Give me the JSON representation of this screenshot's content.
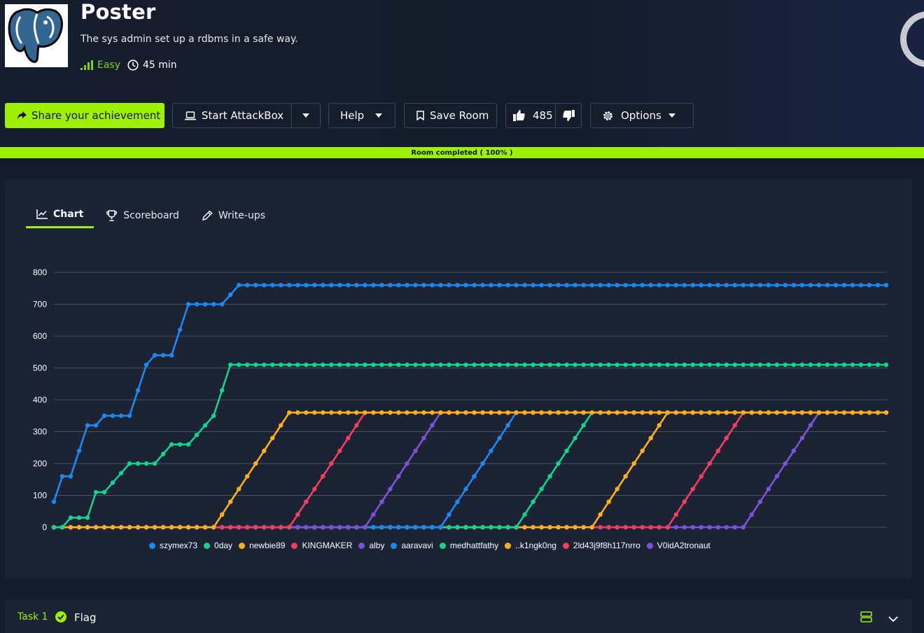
{
  "room": {
    "title": "Poster",
    "description": "The sys admin set up a rdbms in a safe way.",
    "difficulty": "Easy",
    "duration": "45 min",
    "logo_icon": "postgresql-elephant-icon"
  },
  "toolbar": {
    "share_label": "Share your achievement",
    "attackbox_label": "Start AttackBox",
    "help_label": "Help",
    "save_label": "Save Room",
    "votes": "485",
    "options_label": "Options"
  },
  "progress": {
    "label": "Room completed ( 100% )",
    "percent": 100
  },
  "tabs": [
    {
      "label": "Chart",
      "icon": "line-chart-icon",
      "active": true
    },
    {
      "label": "Scoreboard",
      "icon": "trophy-icon",
      "active": false
    },
    {
      "label": "Write-ups",
      "icon": "pencil-icon",
      "active": false
    }
  ],
  "chart_data": {
    "type": "line",
    "ylim": [
      0,
      800
    ],
    "yticks": [
      "800",
      "700",
      "600",
      "500",
      "400",
      "300",
      "200",
      "100",
      "0"
    ],
    "grid": true,
    "legend_placement": "bottom",
    "point_count": 100,
    "series": [
      {
        "name": "szymex73",
        "color": "#1e88f2",
        "points": [
          [
            0,
            80
          ],
          [
            1,
            160
          ],
          [
            2,
            160
          ],
          [
            3,
            240
          ],
          [
            4,
            320
          ],
          [
            5,
            320
          ],
          [
            6,
            350
          ],
          [
            7,
            350
          ],
          [
            8,
            350
          ],
          [
            9,
            350
          ],
          [
            10,
            430
          ],
          [
            11,
            510
          ],
          [
            12,
            540
          ],
          [
            13,
            540
          ],
          [
            14,
            540
          ],
          [
            15,
            620
          ],
          [
            16,
            700
          ],
          [
            17,
            700
          ],
          [
            18,
            700
          ],
          [
            19,
            700
          ],
          [
            20,
            700
          ],
          [
            21,
            730
          ],
          [
            22,
            760
          ],
          [
            99,
            760
          ]
        ]
      },
      {
        "name": "0day",
        "color": "#14d48c",
        "points": [
          [
            0,
            0
          ],
          [
            1,
            0
          ],
          [
            2,
            30
          ],
          [
            3,
            30
          ],
          [
            4,
            30
          ],
          [
            5,
            110
          ],
          [
            6,
            110
          ],
          [
            7,
            140
          ],
          [
            8,
            170
          ],
          [
            9,
            200
          ],
          [
            10,
            200
          ],
          [
            11,
            200
          ],
          [
            12,
            200
          ],
          [
            13,
            230
          ],
          [
            14,
            260
          ],
          [
            15,
            260
          ],
          [
            16,
            260
          ],
          [
            17,
            290
          ],
          [
            18,
            320
          ],
          [
            19,
            350
          ],
          [
            20,
            430
          ],
          [
            21,
            510
          ],
          [
            99,
            510
          ]
        ]
      },
      {
        "name": "newbie89",
        "color": "#fcb020",
        "points": [
          [
            0,
            0
          ],
          [
            19,
            0
          ],
          [
            28,
            360
          ],
          [
            99,
            360
          ]
        ]
      },
      {
        "name": "KINGMAKER",
        "color": "#f33e5e",
        "points": [
          [
            0,
            0
          ],
          [
            28,
            0
          ],
          [
            37,
            360
          ],
          [
            99,
            360
          ]
        ]
      },
      {
        "name": "alby",
        "color": "#7b52d8",
        "points": [
          [
            0,
            0
          ],
          [
            37,
            0
          ],
          [
            46,
            360
          ],
          [
            99,
            360
          ]
        ]
      },
      {
        "name": "aaravavi",
        "color": "#1e88f2",
        "points": [
          [
            0,
            0
          ],
          [
            46,
            0
          ],
          [
            55,
            360
          ],
          [
            99,
            360
          ]
        ]
      },
      {
        "name": "medhattfathy",
        "color": "#14d48c",
        "points": [
          [
            0,
            0
          ],
          [
            55,
            0
          ],
          [
            64,
            360
          ],
          [
            99,
            360
          ]
        ]
      },
      {
        "name": "..k1ngk0ng",
        "color": "#fcb020",
        "points": [
          [
            0,
            0
          ],
          [
            64,
            0
          ],
          [
            73,
            360
          ],
          [
            99,
            360
          ]
        ]
      },
      {
        "name": "2ld43j9f8h117nrro",
        "color": "#f33e5e",
        "points": [
          [
            0,
            0
          ],
          [
            73,
            0
          ],
          [
            82,
            360
          ],
          [
            99,
            360
          ]
        ]
      },
      {
        "name": "V0idA2tronaut",
        "color": "#7b52d8",
        "points": [
          [
            0,
            0
          ],
          [
            82,
            0
          ],
          [
            91,
            360
          ],
          [
            99,
            360
          ]
        ]
      }
    ]
  },
  "task": {
    "number_label": "Task 1",
    "title": "Flag",
    "status_icon": "check-circle-icon"
  }
}
